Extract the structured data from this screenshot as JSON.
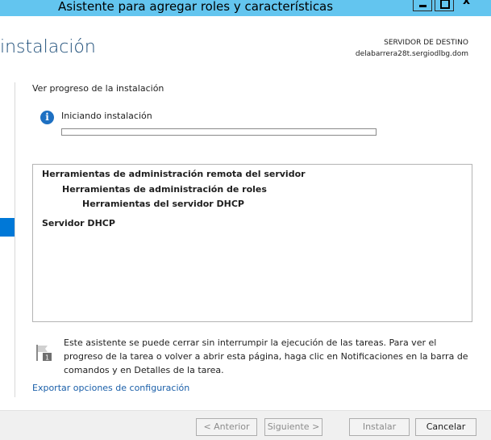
{
  "window": {
    "title": "Asistente para agregar roles y características",
    "close_glyph": "x"
  },
  "header": {
    "title": "instalación",
    "destination_label": "SERVIDOR DE DESTINO",
    "destination_server": "delabarrera28t.sergiodlbg.dom"
  },
  "progress_section": {
    "label": "Ver progreso de la instalación",
    "status_icon": "info-icon",
    "status_icon_glyph": "i",
    "status_text": "Iniciando instalación",
    "progress_fraction": 0.0
  },
  "results": {
    "items": [
      {
        "label": "Herramientas de administración remota del servidor"
      },
      {
        "label": "Herramientas de administración de roles"
      },
      {
        "label": "Herramientas del servidor DHCP"
      },
      {
        "label": "Servidor DHCP"
      }
    ]
  },
  "note": {
    "icon": "notification-flag-icon",
    "badge": "1",
    "text": "Este asistente se puede cerrar sin interrumpir la ejecución de las tareas. Para ver el progreso de la tarea o volver a abrir esta página, haga clic en Notificaciones en la barra de comandos y en Detalles de la tarea."
  },
  "export_link": "Exportar opciones de configuración",
  "buttons": {
    "previous": "< Anterior",
    "next": "Siguiente >",
    "install": "Instalar",
    "cancel": "Cancelar"
  },
  "colors": {
    "titlebar": "#63c5ef",
    "accent": "#0078d7",
    "link": "#1a5fa9"
  }
}
